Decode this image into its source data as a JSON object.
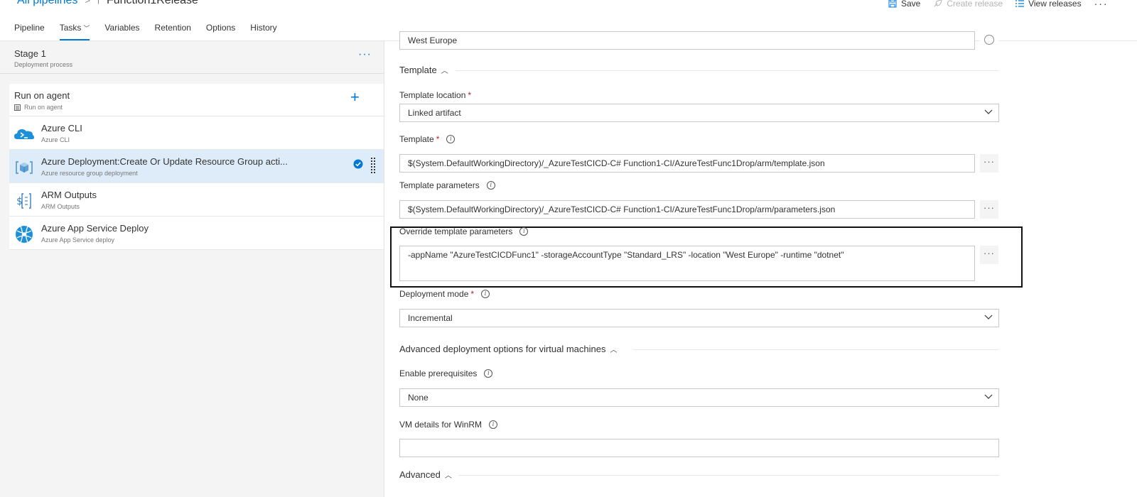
{
  "header": {
    "breadcrumb_root": "All pipelines",
    "breadcrumb_sep": ">",
    "pipeline_name": "Function1Release",
    "actions": {
      "save": "Save",
      "create_release": "Create release",
      "view_releases": "View releases"
    }
  },
  "tabs": [
    {
      "label": "Pipeline"
    },
    {
      "label": "Tasks"
    },
    {
      "label": "Variables"
    },
    {
      "label": "Retention"
    },
    {
      "label": "Options"
    },
    {
      "label": "History"
    }
  ],
  "stage": {
    "title": "Stage 1",
    "subtitle": "Deployment process"
  },
  "job": {
    "title": "Run on agent",
    "subtitle": "Run on agent"
  },
  "tasks": [
    {
      "title": "Azure CLI",
      "subtitle": "Azure CLI",
      "icon": "azure-cli-icon"
    },
    {
      "title": "Azure Deployment:Create Or Update Resource Group acti...",
      "subtitle": "Azure resource group deployment",
      "icon": "resource-group-icon",
      "selected": true
    },
    {
      "title": "ARM Outputs",
      "subtitle": "ARM Outputs",
      "icon": "arm-outputs-icon"
    },
    {
      "title": "Azure App Service Deploy",
      "subtitle": "Azure App Service deploy",
      "icon": "app-service-icon"
    }
  ],
  "form": {
    "location_value": "West Europe",
    "template_section": "Template",
    "template_location": {
      "label": "Template location",
      "value": "Linked artifact"
    },
    "template": {
      "label": "Template",
      "value": "$(System.DefaultWorkingDirectory)/_AzureTestCICD-C# Function1-CI/AzureTestFunc1Drop/arm/template.json"
    },
    "template_parameters": {
      "label": "Template parameters",
      "value": "$(System.DefaultWorkingDirectory)/_AzureTestCICD-C# Function1-CI/AzureTestFunc1Drop/arm/parameters.json"
    },
    "override_parameters": {
      "label": "Override template parameters",
      "value": "-appName \"AzureTestCICDFunc1\" -storageAccountType \"Standard_LRS\" -location \"West Europe\" -runtime \"dotnet\""
    },
    "deployment_mode": {
      "label": "Deployment mode",
      "value": "Incremental"
    },
    "advanced_vm_section": "Advanced deployment options for virtual machines",
    "enable_prerequisites": {
      "label": "Enable prerequisites",
      "value": "None"
    },
    "vm_details": {
      "label": "VM details for WinRM",
      "value": ""
    },
    "advanced_section": "Advanced",
    "required_mark": "*",
    "info_glyph": "i",
    "ellipsis": "···"
  },
  "colors": {
    "accent": "#0078d4",
    "selected_row": "#deecf9",
    "panel_bg": "#f4f4f4"
  }
}
